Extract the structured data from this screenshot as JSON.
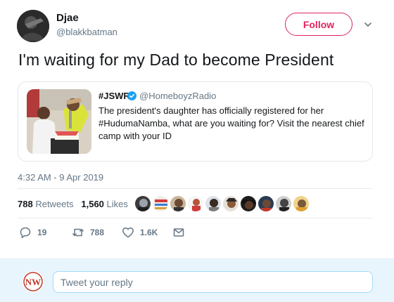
{
  "author": {
    "name": "Djae",
    "handle": "@blakkbatman",
    "follow_label": "Follow"
  },
  "tweet": {
    "text": "I'm waiting for my Dad to become President",
    "timestamp": "4:32 AM - 9 Apr 2019"
  },
  "quoted": {
    "name": "#JSWR",
    "handle": "@HomeboyzRadio",
    "text": "The president's daughter has officially registered for her #HudumaNamba, what are you waiting for? Visit the nearest chief camp with your ID"
  },
  "stats": {
    "retweets_count": "788",
    "retweets_label": "Retweets",
    "likes_count": "1,560",
    "likes_label": "Likes"
  },
  "actions": {
    "replies": "19",
    "retweets": "788",
    "likes": "1.6K"
  },
  "reply": {
    "avatar_text": "NW",
    "placeholder": "Tweet your reply"
  },
  "colors": {
    "brand_red": "#e0245e",
    "muted": "#657786",
    "verified_blue": "#1da1f2",
    "reply_bg": "#e8f5fd"
  }
}
